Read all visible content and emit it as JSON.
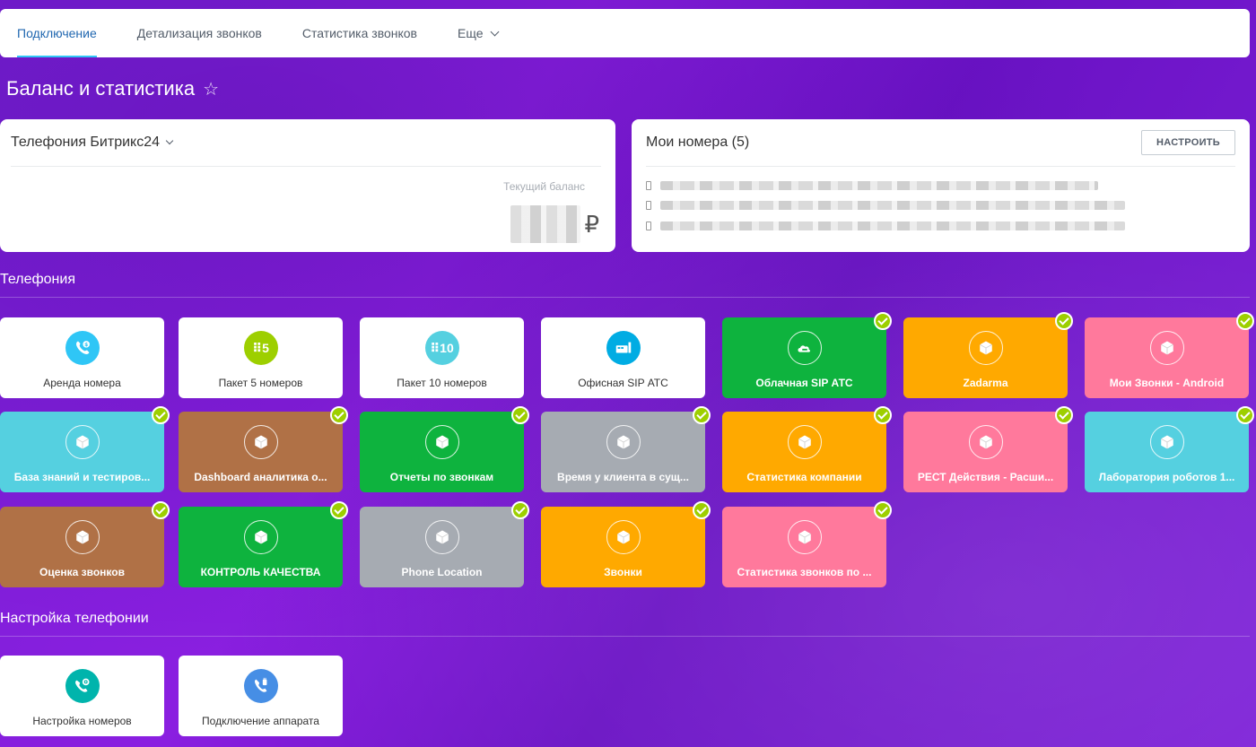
{
  "nav": {
    "tabs": [
      {
        "label": "Подключение",
        "active": true
      },
      {
        "label": "Детализация звонков"
      },
      {
        "label": "Статистика звонков"
      },
      {
        "label": "Еще"
      }
    ]
  },
  "page": {
    "title": "Баланс и статистика"
  },
  "balance_card": {
    "title": "Телефония Битрикс24",
    "balance_label": "Текущий баланс",
    "currency": "₽"
  },
  "numbers_card": {
    "title": "Мои номера (5)",
    "config_button": "НАСТРОИТЬ"
  },
  "sections": {
    "telephony": "Телефония",
    "telephony_settings": "Настройка телефонии"
  },
  "colors": {
    "white": "#ffffff",
    "green": "#0eb33e",
    "orange": "#ffa900",
    "pink": "#ff799c",
    "cyan": "#55d0e0",
    "brown": "#b07146",
    "gray": "#a6abb2",
    "check": "#9dcf00"
  },
  "tiles": [
    {
      "label": "Аренда номера",
      "style": "white",
      "icon": "phone-rent-icon",
      "icon_color": "#2fc6f6"
    },
    {
      "label": "Пакет 5 номеров",
      "style": "white",
      "icon": "package-5-icon",
      "icon_color": "#9dcf00",
      "icon_text": "⠿5"
    },
    {
      "label": "Пакет 10 номеров",
      "style": "white",
      "icon": "package-10-icon",
      "icon_color": "#55d0e0",
      "icon_text": "⠿10"
    },
    {
      "label": "Офисная SIP АТС",
      "style": "white",
      "icon": "office-sip-icon",
      "icon_color": "#00ace3"
    },
    {
      "label": "Облачная SIP АТС",
      "style": "green",
      "icon": "cloud-sip-icon",
      "checked": true
    },
    {
      "label": "Zadarma",
      "style": "orange",
      "icon": "cube-icon",
      "checked": true
    },
    {
      "label": "Мои Звонки - Android",
      "style": "pink",
      "icon": "cube-icon",
      "checked": true
    },
    {
      "label": "База знаний и тестиров...",
      "style": "cyan",
      "icon": "cube-icon",
      "checked": true
    },
    {
      "label": "Dashboard аналитика о...",
      "style": "brown",
      "icon": "cube-icon",
      "checked": true
    },
    {
      "label": "Отчеты по звонкам",
      "style": "green",
      "icon": "cube-icon",
      "checked": true
    },
    {
      "label": "Время у клиента в сущ...",
      "style": "gray",
      "icon": "cube-icon",
      "checked": true
    },
    {
      "label": "Статистика компании",
      "style": "orange",
      "icon": "cube-icon",
      "checked": true
    },
    {
      "label": "РЕСТ Действия - Расши...",
      "style": "pink",
      "icon": "cube-icon",
      "checked": true
    },
    {
      "label": "Лаборатория роботов 1...",
      "style": "cyan",
      "icon": "cube-icon",
      "checked": true
    },
    {
      "label": "Оценка звонков",
      "style": "brown",
      "icon": "cube-icon",
      "checked": true
    },
    {
      "label": "КОНТРОЛЬ КАЧЕСТВА",
      "style": "green",
      "icon": "cube-icon",
      "checked": true
    },
    {
      "label": "Phone Location",
      "style": "gray",
      "icon": "cube-icon",
      "checked": true
    },
    {
      "label": "Звонки",
      "style": "orange",
      "icon": "cube-icon",
      "checked": true
    },
    {
      "label": "Статистика звонков по ...",
      "style": "pink",
      "icon": "cube-icon",
      "checked": true
    }
  ],
  "settings_tiles": [
    {
      "label": "Настройка номеров",
      "style": "white",
      "icon": "number-settings-icon",
      "icon_color": "#00b4ac"
    },
    {
      "label": "Подключение аппарата",
      "style": "white",
      "icon": "device-connect-icon",
      "icon_color": "#468ee5"
    }
  ]
}
